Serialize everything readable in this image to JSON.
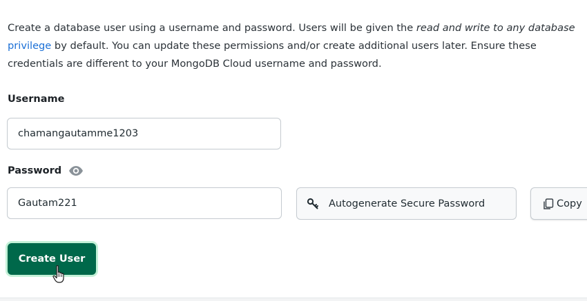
{
  "intro": {
    "line1_a": "Create a database user using a username and password. Users will be given the ",
    "line1_em": "read and write to any database",
    "line2_link": "privilege",
    "line2_b": " by default. You can update these permissions and/or create additional users later. Ensure these",
    "line3": "credentials are different to your MongoDB Cloud username and password."
  },
  "username": {
    "label": "Username",
    "value": "chamangautamme1203"
  },
  "password": {
    "label": "Password",
    "value": "Gautam221",
    "toggle_icon": "eye-icon"
  },
  "buttons": {
    "autogenerate": "Autogenerate Secure Password",
    "copy": "Copy",
    "create_user": "Create User"
  },
  "colors": {
    "primary": "#00684a",
    "primary_ring": "#c3f1d7",
    "link": "#1a6fd6"
  }
}
